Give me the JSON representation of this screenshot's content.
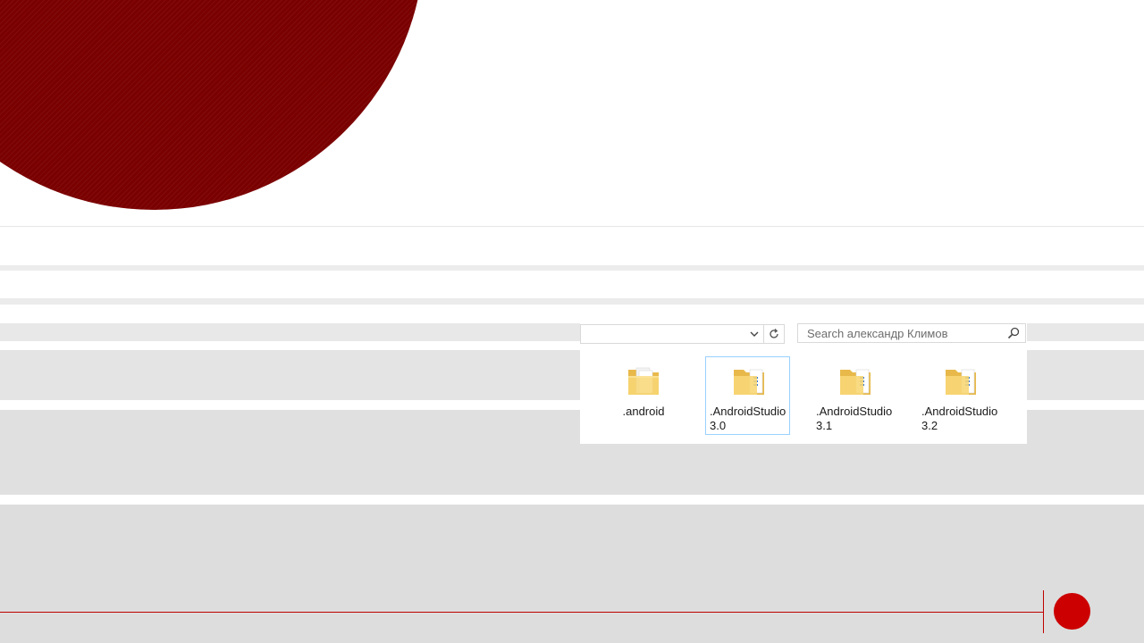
{
  "explorer": {
    "search": {
      "placeholder": "Search александр Климов"
    },
    "refresh_icon": "refresh-icon",
    "chevron_icon": "chevron-down-icon",
    "items": [
      {
        "label": ".android",
        "icon": "folder-icon",
        "selected": false
      },
      {
        "label": ".AndroidStudio3.0",
        "icon": "folder-icon",
        "selected": true
      },
      {
        "label": ".AndroidStudio3.1",
        "icon": "folder-icon",
        "selected": false
      },
      {
        "label": ".AndroidStudio3.2",
        "icon": "folder-icon",
        "selected": false
      }
    ]
  },
  "colors": {
    "accent_dark_red": "#7a0000",
    "accent_red": "#cc0000",
    "selection_border": "#99d1ff",
    "folder_yellow": "#f8d775"
  }
}
